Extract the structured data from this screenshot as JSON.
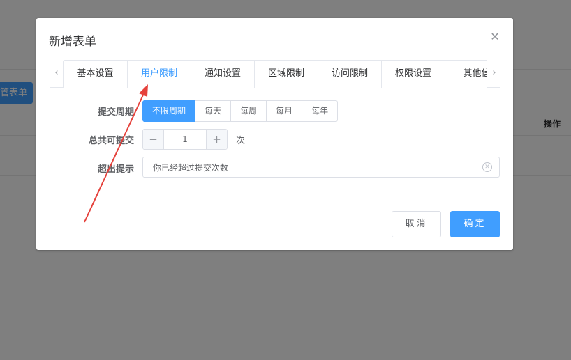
{
  "background": {
    "button_label": "管表单",
    "column_action": "操作"
  },
  "dialog": {
    "title": "新增表单",
    "close_glyph": "✕",
    "tabs": [
      {
        "label": "基本设置",
        "active": false
      },
      {
        "label": "用户限制",
        "active": true
      },
      {
        "label": "通知设置",
        "active": false
      },
      {
        "label": "区域限制",
        "active": false
      },
      {
        "label": "访问限制",
        "active": false
      },
      {
        "label": "权限设置",
        "active": false
      },
      {
        "label": "其他信",
        "active": false
      }
    ],
    "tab_prev_glyph": "‹",
    "tab_next_glyph": "›",
    "form": {
      "period_label": "提交周期",
      "period_options": [
        {
          "label": "不限周期",
          "active": true
        },
        {
          "label": "每天",
          "active": false
        },
        {
          "label": "每周",
          "active": false
        },
        {
          "label": "每月",
          "active": false
        },
        {
          "label": "每年",
          "active": false
        }
      ],
      "total_label": "总共可提交",
      "total_value": "1",
      "minus_glyph": "−",
      "plus_glyph": "+",
      "total_unit": "次",
      "exceed_label": "超出提示",
      "exceed_value": "你已经超过提交次数",
      "clear_glyph": "✕"
    },
    "cancel_label": "取消",
    "ok_label": "确定"
  },
  "colors": {
    "primary": "#409eff",
    "arrow": "#e5413b",
    "overlay": "rgba(0,0,0,0.5)"
  }
}
